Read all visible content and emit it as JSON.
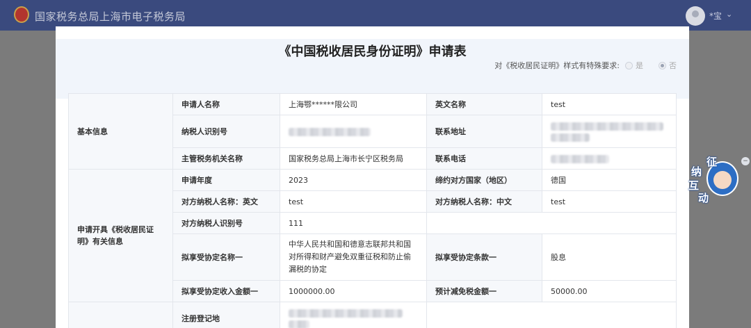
{
  "header": {
    "site_title": "国家税务总局上海市电子税务局",
    "user_name": "*宝",
    "caret": "⌄"
  },
  "modal": {
    "title": "《中国税收居民身份证明》申请表",
    "special_question": "对《税收居民证明》样式有特殊要求:",
    "option_yes": "是",
    "option_no": "否",
    "selected": "否"
  },
  "form": {
    "section_basic": "基本信息",
    "section_cert": "申请开具《税收居民证明》有关信息",
    "applicant_name_label": "申请人名称",
    "applicant_name": "上海鄂******限公司",
    "english_name_label": "英文名称",
    "english_name": "test",
    "tax_id_label": "纳税人识别号",
    "address_label": "联系地址",
    "authority_label": "主管税务机关名称",
    "authority": "国家税务总局上海市长宁区税务局",
    "phone_label": "联系电话",
    "year_label": "申请年度",
    "year": "2023",
    "country_label": "缔约对方国家（地区）",
    "country": "德国",
    "cp_name_en_label": "对方纳税人名称：英文",
    "cp_name_en": "test",
    "cp_name_cn_label": "对方纳税人名称：中文",
    "cp_name_cn": "test",
    "cp_tax_id_label": "对方纳税人识别号",
    "cp_tax_id": "111",
    "treaty_label": "拟享受协定名称一",
    "treaty": "中华人民共和国和德意志联邦共和国对所得和财产避免双重征税和防止偷漏税的协定",
    "clause_label": "拟享受协定条款一",
    "clause": "股息",
    "income_label": "拟享受协定收入金额一",
    "income": "1000000.00",
    "relief_label": "预计减免税金额一",
    "relief": "50000.00",
    "reg_place_label": "注册登记地"
  },
  "floater": {
    "chars": [
      "征",
      "纳",
      "互",
      "动"
    ]
  },
  "colors": {
    "topbar": "#3a4a7e",
    "label_bg": "#f6f8fb",
    "border": "#e3e6ec"
  }
}
